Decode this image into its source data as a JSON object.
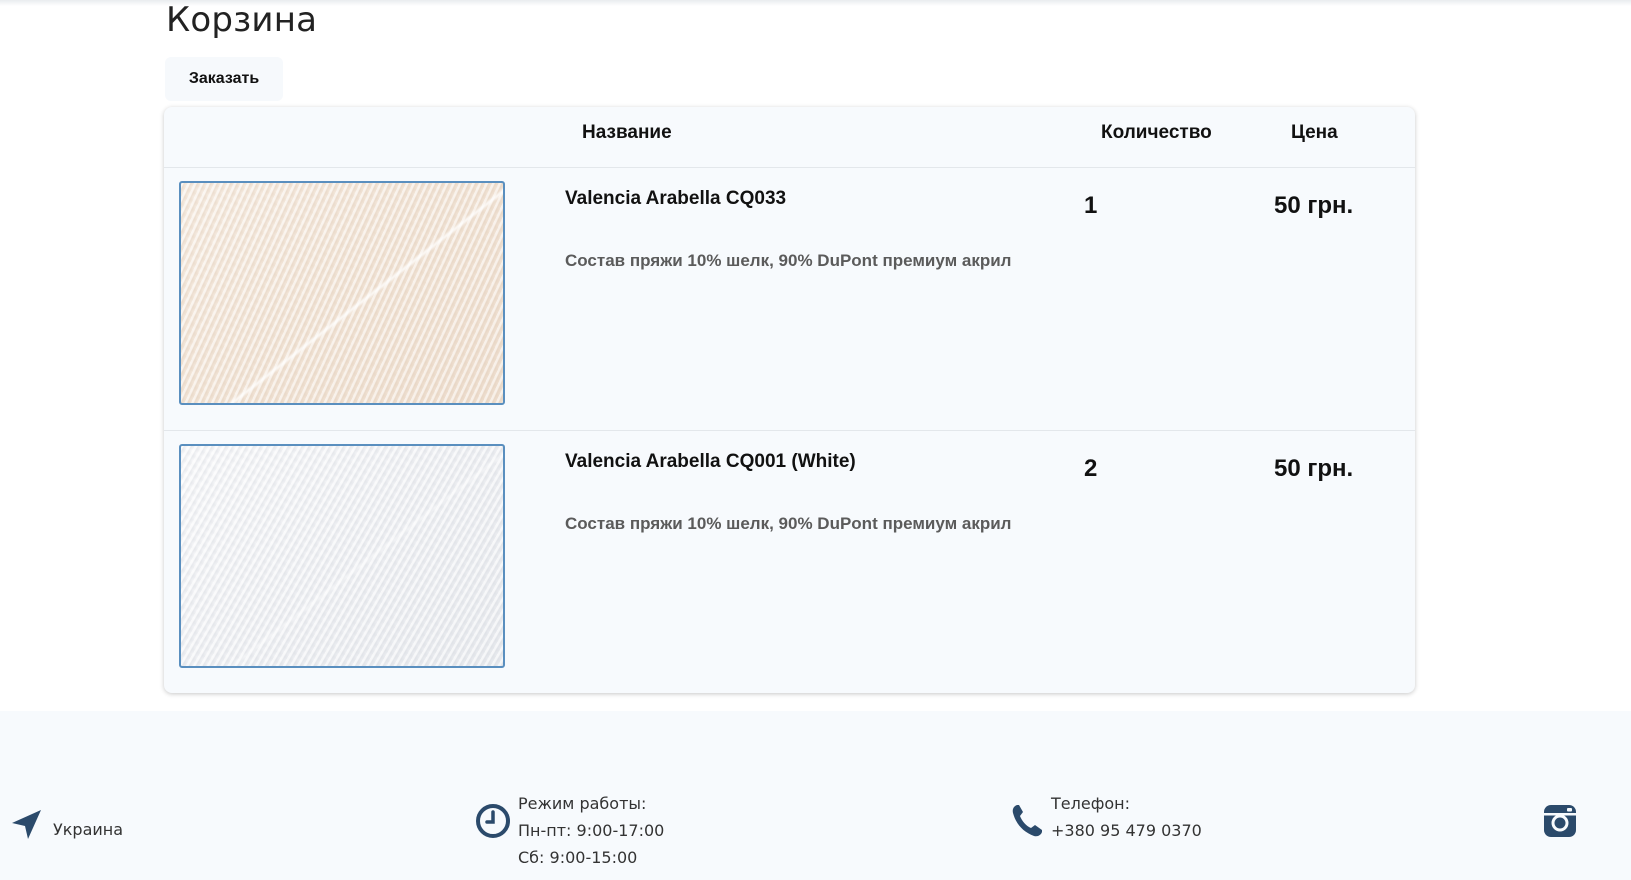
{
  "page": {
    "title": "Корзина",
    "order_button": "Заказать"
  },
  "table": {
    "headers": {
      "name": "Название",
      "quantity": "Количество",
      "price": "Цена"
    },
    "items": [
      {
        "name": "Valencia Arabella CQ033",
        "description": "Состав пряжи 10% шелк, 90% DuPont премиум акрил",
        "quantity": "1",
        "price": "50 грн.",
        "image_icon": "yarn-image"
      },
      {
        "name": "Valencia Arabella CQ001 (White)",
        "description": "Состав пряжи 10% шелк, 90% DuPont премиум акрил",
        "quantity": "2",
        "price": "50 грн.",
        "image_icon": "yarn-image"
      }
    ]
  },
  "footer": {
    "location": "Украина",
    "hours_label": "Режим работы:",
    "hours_weekdays": "Пн-пт: 9:00-17:00",
    "hours_saturday": "Сб: 9:00-15:00",
    "phone_label": "Телефон:",
    "phone_number": "+380 95 479 0370",
    "icons": [
      "location-arrow-icon",
      "clock-icon",
      "phone-icon",
      "instagram-icon"
    ]
  },
  "colors": {
    "icon_navy": "#2b4a6b",
    "table_bg": "#f7fafd",
    "thumb_border": "#5a8fbf"
  }
}
